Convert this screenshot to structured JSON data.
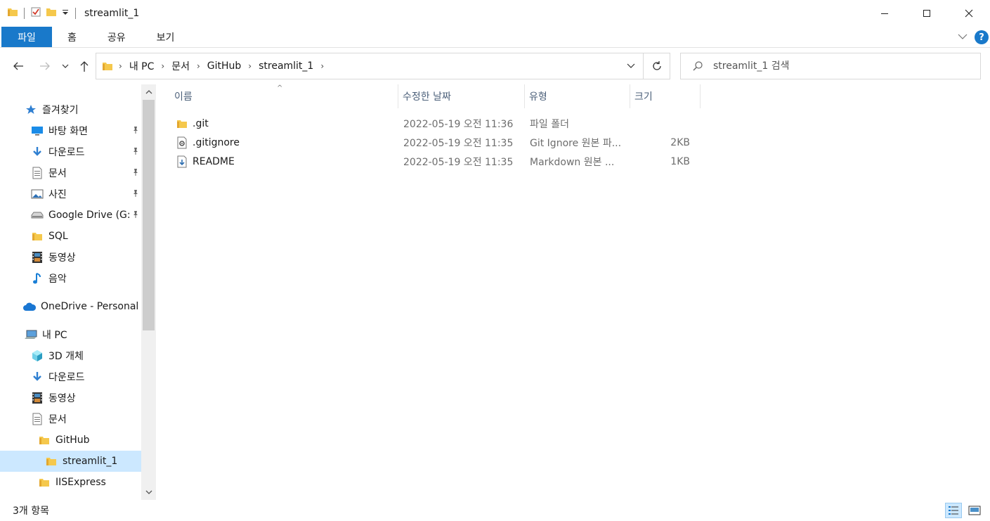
{
  "window": {
    "title": "streamlit_1"
  },
  "ribbon": {
    "tabs": [
      "파일",
      "홈",
      "공유",
      "보기"
    ]
  },
  "address": {
    "crumbs": [
      "내 PC",
      "문서",
      "GitHub",
      "streamlit_1"
    ]
  },
  "search": {
    "placeholder": "streamlit_1 검색"
  },
  "nav": {
    "items": [
      {
        "label": "즐겨찾기",
        "icon": "star-icon",
        "pinned": false
      },
      {
        "label": "바탕 화면",
        "icon": "desktop-icon",
        "pinned": true
      },
      {
        "label": "다운로드",
        "icon": "download-arrow-icon",
        "pinned": true
      },
      {
        "label": "문서",
        "icon": "document-icon",
        "pinned": true
      },
      {
        "label": "사진",
        "icon": "pictures-icon",
        "pinned": true
      },
      {
        "label": "Google Drive (G:",
        "icon": "drive-icon",
        "pinned": true
      },
      {
        "label": "SQL",
        "icon": "folder-icon",
        "pinned": false
      },
      {
        "label": "동영상",
        "icon": "video-icon",
        "pinned": false
      },
      {
        "label": "음악",
        "icon": "music-note-icon",
        "pinned": false
      },
      {
        "label": "OneDrive - Personal",
        "icon": "cloud-icon",
        "pinned": false
      },
      {
        "label": "내 PC",
        "icon": "computer-icon",
        "pinned": false
      },
      {
        "label": "3D 개체",
        "icon": "cube-icon",
        "pinned": false
      },
      {
        "label": "다운로드",
        "icon": "download-arrow-icon",
        "pinned": false
      },
      {
        "label": "동영상",
        "icon": "video-icon",
        "pinned": false
      },
      {
        "label": "문서",
        "icon": "document-icon",
        "pinned": false
      },
      {
        "label": "GitHub",
        "icon": "folder-icon",
        "pinned": false
      },
      {
        "label": "streamlit_1",
        "icon": "folder-icon",
        "pinned": false,
        "selected": true
      },
      {
        "label": "IISExpress",
        "icon": "folder-icon",
        "pinned": false
      }
    ]
  },
  "columns": {
    "name": "이름",
    "date": "수정한 날짜",
    "type": "유형",
    "size": "크기"
  },
  "files": [
    {
      "name": ".git",
      "date": "2022-05-19 오전 11:36",
      "type": "파일 폴더",
      "size": "",
      "icon": "folder-icon"
    },
    {
      "name": ".gitignore",
      "date": "2022-05-19 오전 11:35",
      "type": "Git Ignore 원본 파...",
      "size": "2KB",
      "icon": "settings-file-icon"
    },
    {
      "name": "README",
      "date": "2022-05-19 오전 11:35",
      "type": "Markdown 원본 ...",
      "size": "1KB",
      "icon": "markdown-file-icon"
    }
  ],
  "status": {
    "text": "3개 항목"
  },
  "colors": {
    "accent": "#1979ca",
    "selected": "#cce8ff",
    "folder": "#f5c84c"
  }
}
